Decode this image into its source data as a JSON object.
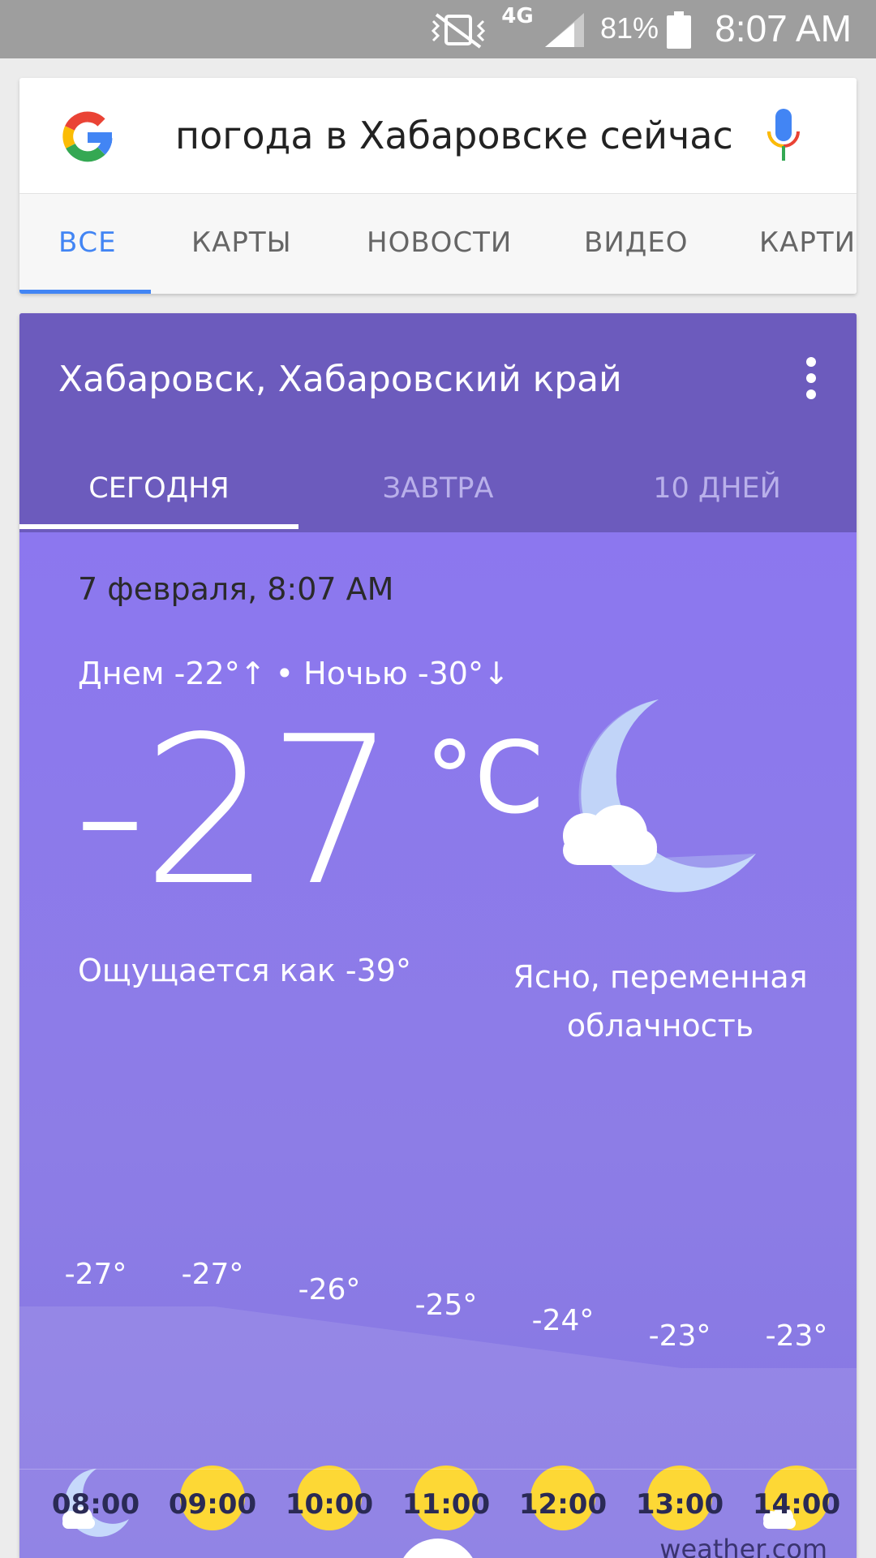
{
  "status_bar": {
    "network": "4G",
    "battery_percent": "81%",
    "time": "8:07 AM"
  },
  "search": {
    "query": "погода в Хабаровске сейчас",
    "tabs": [
      {
        "label": "ВСЕ",
        "active": true
      },
      {
        "label": "КАРТЫ"
      },
      {
        "label": "НОВОСТИ"
      },
      {
        "label": "ВИДЕО"
      },
      {
        "label": "КАРТИ"
      }
    ]
  },
  "weather": {
    "location": "Хабаровск, Хабаровский край",
    "tabs": [
      {
        "label": "СЕГОДНЯ",
        "active": true
      },
      {
        "label": "ЗАВТРА"
      },
      {
        "label": "10 ДНЕЙ"
      }
    ],
    "date": "7 февраля, 8:07 AM",
    "hilo": "Днем -22°↑ • Ночью -30°↓",
    "temperature": "-27",
    "unit": "°C",
    "feels_like": "Ощущается как -39°",
    "condition": "Ясно, переменная облачность",
    "hourly": [
      {
        "time": "08:00",
        "temp": "-27°",
        "value": -27,
        "icon": "moon-cloud-icon"
      },
      {
        "time": "09:00",
        "temp": "-27°",
        "value": -27,
        "icon": "sun-icon"
      },
      {
        "time": "10:00",
        "temp": "-26°",
        "value": -26,
        "icon": "sun-icon"
      },
      {
        "time": "11:00",
        "temp": "-25°",
        "value": -25,
        "icon": "sun-icon"
      },
      {
        "time": "12:00",
        "temp": "-24°",
        "value": -24,
        "icon": "sun-icon"
      },
      {
        "time": "13:00",
        "temp": "-23°",
        "value": -23,
        "icon": "sun-icon"
      },
      {
        "time": "14:00",
        "temp": "-23°",
        "value": -23,
        "icon": "sun-cloud-icon"
      }
    ],
    "source": "weather.com"
  },
  "colors": {
    "accent": "#4285f4",
    "header_purple": "#6c5bbd",
    "body_purple": "#8a79e8",
    "sun": "#fdd835"
  }
}
